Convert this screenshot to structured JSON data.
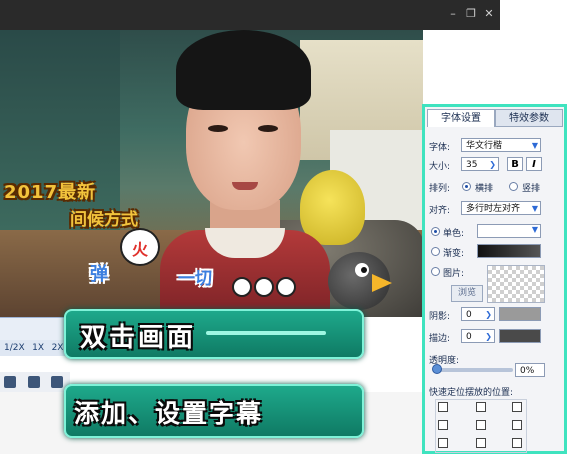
{
  "window": {
    "minimize_icon": "minimize-icon",
    "restore_icon": "restore-icon",
    "close_icon": "close-icon"
  },
  "video_overlay": {
    "line1": "2017最新",
    "line2": "间候方式",
    "bubble": "火",
    "text_left": "弹",
    "text_right": "一切"
  },
  "speed": {
    "options": [
      "1/2X",
      "1X",
      "2X"
    ]
  },
  "banners": {
    "top": "双击画面",
    "bottom": "添加、设置字幕"
  },
  "panel": {
    "tabs": [
      "字体设置",
      "特效参数"
    ],
    "font_label": "字体:",
    "font_value": "华文行楷",
    "size_label": "大小:",
    "size_value": "35",
    "bold": "B",
    "italic": "I",
    "layout_label": "排列:",
    "horizontal": "横排",
    "vertical": "竖排",
    "align_label": "对齐:",
    "align_value": "多行时左对齐",
    "solid_label": "单色:",
    "gradient_label": "渐变:",
    "image_label": "图片:",
    "browse": "浏览",
    "shadow_label": "阴影:",
    "shadow_value": "0",
    "stroke_label": "描边:",
    "stroke_value": "0",
    "opacity_label": "透明度:",
    "opacity_value": "0%",
    "position_label": "快速定位摆放的位置:"
  }
}
